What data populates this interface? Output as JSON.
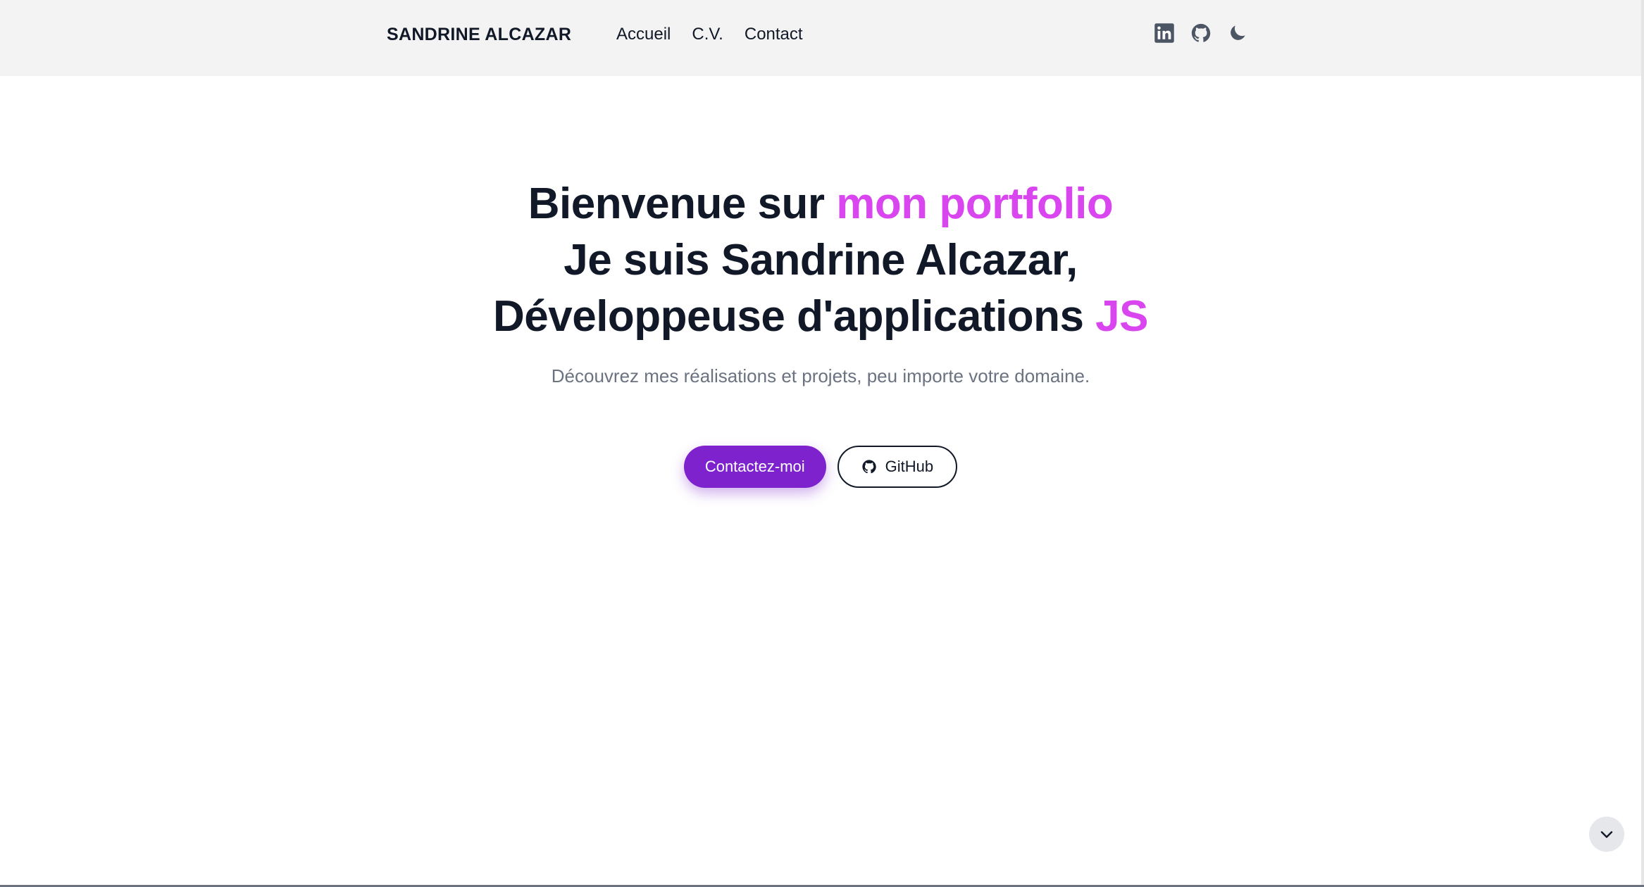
{
  "header": {
    "brand": "SANDRINE ALCAZAR",
    "nav": [
      {
        "label": "Accueil"
      },
      {
        "label": "C.V."
      },
      {
        "label": "Contact"
      }
    ],
    "icons": [
      "linkedin-icon",
      "github-icon",
      "moon-icon"
    ]
  },
  "hero": {
    "line1_prefix": "Bienvenue sur ",
    "line1_accent": "mon portfolio",
    "line2": "Je suis Sandrine Alcazar,",
    "line3_prefix": "Développeuse d'applications ",
    "line3_accent": "JS",
    "subtitle": "Découvrez mes réalisations et projets, peu importe votre domaine."
  },
  "actions": {
    "contact_label": "Contactez-moi",
    "github_label": "GitHub"
  },
  "colors": {
    "accent": "#d946ef",
    "primary_button": "#7e22ce",
    "header_bg": "#f3f3f3",
    "text": "#111827",
    "muted": "#6b7280"
  }
}
